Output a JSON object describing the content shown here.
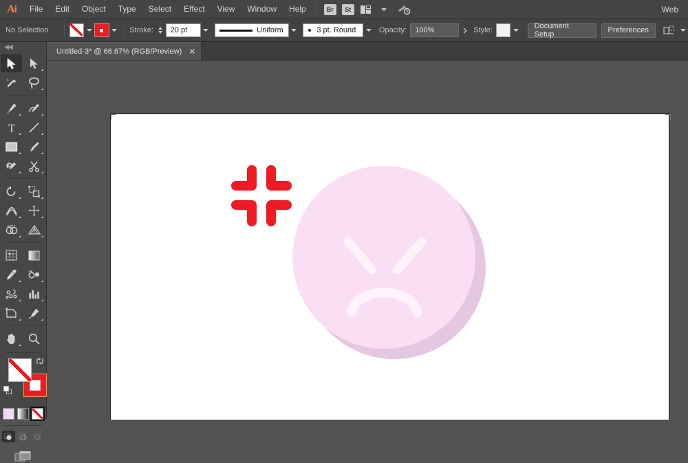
{
  "app": {
    "name": "Adobe Illustrator",
    "logo_text": "Ai",
    "workspace_label": "Web"
  },
  "menubar": {
    "items": [
      {
        "label": "File"
      },
      {
        "label": "Edit"
      },
      {
        "label": "Object"
      },
      {
        "label": "Type"
      },
      {
        "label": "Select"
      },
      {
        "label": "Effect"
      },
      {
        "label": "View"
      },
      {
        "label": "Window"
      },
      {
        "label": "Help"
      }
    ],
    "bridge_badge": "Br",
    "stock_badge": "St",
    "arrange_documents_icon": "arrange-documents-icon",
    "search_icon": "search-adobe-stock-icon"
  },
  "controlbar": {
    "selection_status": "No Selection",
    "fill_label": "fill-swatch",
    "fill_value": "None",
    "stroke_swatch_label": "stroke-swatch",
    "stroke_value": "Red",
    "stroke_label": "Stroke:",
    "stroke_weight": "20 pt",
    "stroke_profile": "Uniform",
    "brush_definition": "3 pt. Round",
    "opacity_label": "Opacity:",
    "opacity_value": "100%",
    "style_label": "Style:",
    "document_setup_button": "Document Setup",
    "preferences_button": "Preferences",
    "align_icon": "align-to-selection-icon"
  },
  "tabbar": {
    "tab_title": "Untitled-3* @ 66.67% (RGB/Preview)",
    "close_glyph": "✕"
  },
  "toolpanel": {
    "tools": [
      [
        {
          "name": "selection-tool",
          "active": true
        },
        {
          "name": "direct-selection-tool",
          "active": false
        }
      ],
      [
        {
          "name": "magic-wand-tool",
          "active": false
        },
        {
          "name": "lasso-tool",
          "active": false
        }
      ],
      [
        {
          "name": "pen-tool",
          "active": false
        },
        {
          "name": "curvature-tool",
          "active": false
        }
      ],
      [
        {
          "name": "type-tool",
          "active": false
        },
        {
          "name": "line-segment-tool",
          "active": false
        }
      ],
      [
        {
          "name": "rectangle-tool",
          "active": false
        },
        {
          "name": "paintbrush-tool",
          "active": false
        }
      ],
      [
        {
          "name": "shaper-pencil-tool",
          "active": false
        },
        {
          "name": "scissors-tool",
          "active": false
        }
      ],
      [
        {
          "name": "rotate-tool",
          "active": false
        },
        {
          "name": "scale-tool",
          "active": false
        }
      ],
      [
        {
          "name": "width-tool",
          "active": false
        },
        {
          "name": "free-transform-tool",
          "active": false
        }
      ],
      [
        {
          "name": "shape-builder-tool",
          "active": false
        },
        {
          "name": "perspective-grid-tool",
          "active": false
        }
      ],
      [
        {
          "name": "mesh-tool",
          "active": false
        },
        {
          "name": "gradient-tool",
          "active": false
        }
      ],
      [
        {
          "name": "eyedropper-tool",
          "active": false
        },
        {
          "name": "blend-tool",
          "active": false
        }
      ],
      [
        {
          "name": "symbol-sprayer-tool",
          "active": false
        },
        {
          "name": "column-graph-tool",
          "active": false
        }
      ],
      [
        {
          "name": "artboard-tool",
          "active": false
        },
        {
          "name": "slice-tool",
          "active": false
        }
      ],
      [
        {
          "name": "hand-tool",
          "active": false
        },
        {
          "name": "zoom-tool",
          "active": false
        }
      ]
    ],
    "fill_stroke": {
      "fill_state": "None",
      "stroke_state": "Red",
      "swap_icon": "swap-fill-stroke-icon",
      "default_icon": "default-fill-stroke-icon"
    },
    "color_modes": [
      {
        "name": "color-swatch-button",
        "selected": false
      },
      {
        "name": "gradient-swatch-button",
        "selected": false
      },
      {
        "name": "none-swatch-button",
        "selected": true
      }
    ],
    "draw_modes": [
      {
        "name": "draw-normal-button",
        "selected": true
      },
      {
        "name": "draw-behind-button",
        "selected": false
      },
      {
        "name": "draw-inside-button",
        "selected": false
      }
    ],
    "screen_mode": "change-screen-mode-button"
  },
  "canvas": {
    "zoom_level": "66.67%",
    "artboard_background": "#ffffff",
    "artwork": {
      "cross": {
        "name": "red-cross-shape",
        "color": "#ed1c24",
        "description": "Red pinwheel cross made of four rounded L-strokes"
      },
      "face": {
        "name": "angry-face-emoji",
        "shadow_color": "#e4c8e2",
        "body_color": "#fadff4",
        "feature_color": "#fdf3fb",
        "expression": "angry-frown",
        "eyes": 2,
        "mouth": "frown-arc"
      }
    }
  }
}
